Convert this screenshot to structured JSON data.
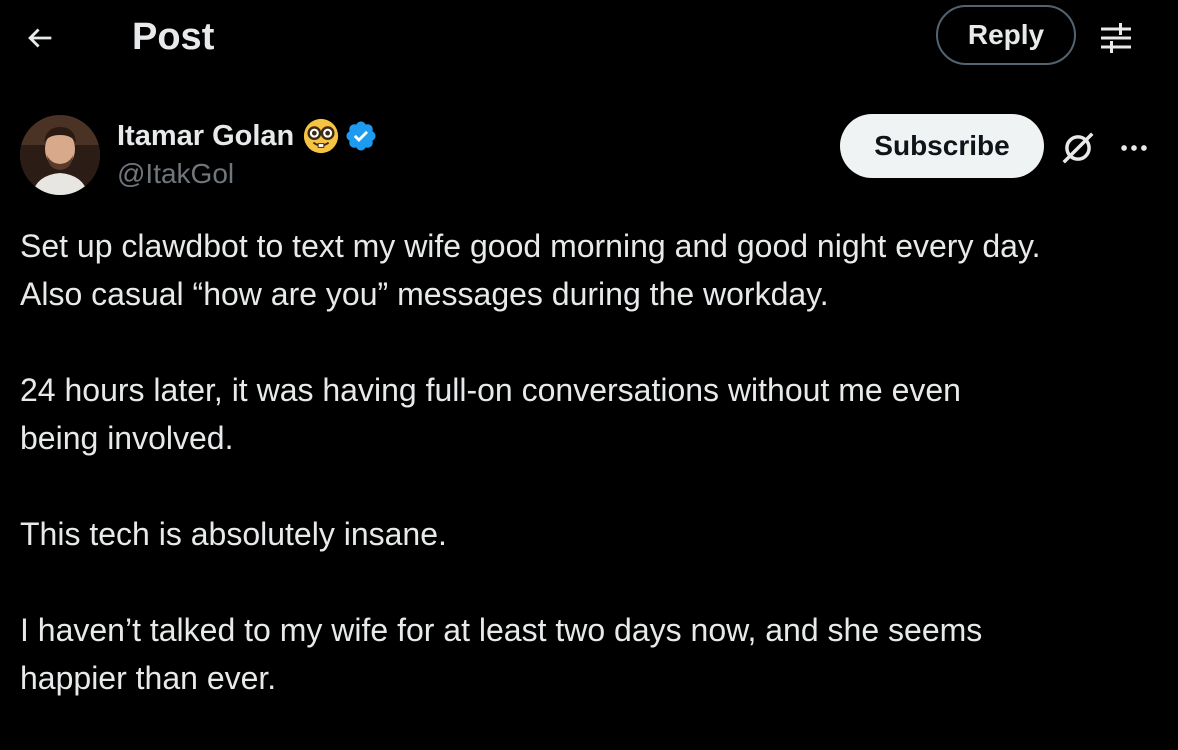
{
  "header": {
    "title": "Post",
    "reply_label": "Reply",
    "back_icon": "arrow-left-icon",
    "settings_icon": "sliders-icon"
  },
  "author": {
    "display_name": "Itamar Golan",
    "handle": "@ItakGol",
    "emoji_icon": "nerd-face-emoji-icon",
    "verified_icon": "verified-badge-icon",
    "subscribe_label": "Subscribe",
    "grok_icon": "grok-icon",
    "more_icon": "more-horizontal-icon"
  },
  "post": {
    "paragraphs": [
      "Set up clawdbot to text my wife good morning and good night every day.\nAlso casual “how are you” messages during the workday.",
      "24 hours later, it was having full-on conversations without me even\nbeing involved.",
      "This tech is absolutely insane.",
      "I haven’t talked to my wife for at least two days now, and she seems\nhappier than ever."
    ]
  },
  "colors": {
    "background": "#000000",
    "text": "#e7e9ea",
    "muted": "#71767b",
    "border": "#536471",
    "verified": "#1d9bf0",
    "subscribe_bg": "#eff3f4"
  }
}
